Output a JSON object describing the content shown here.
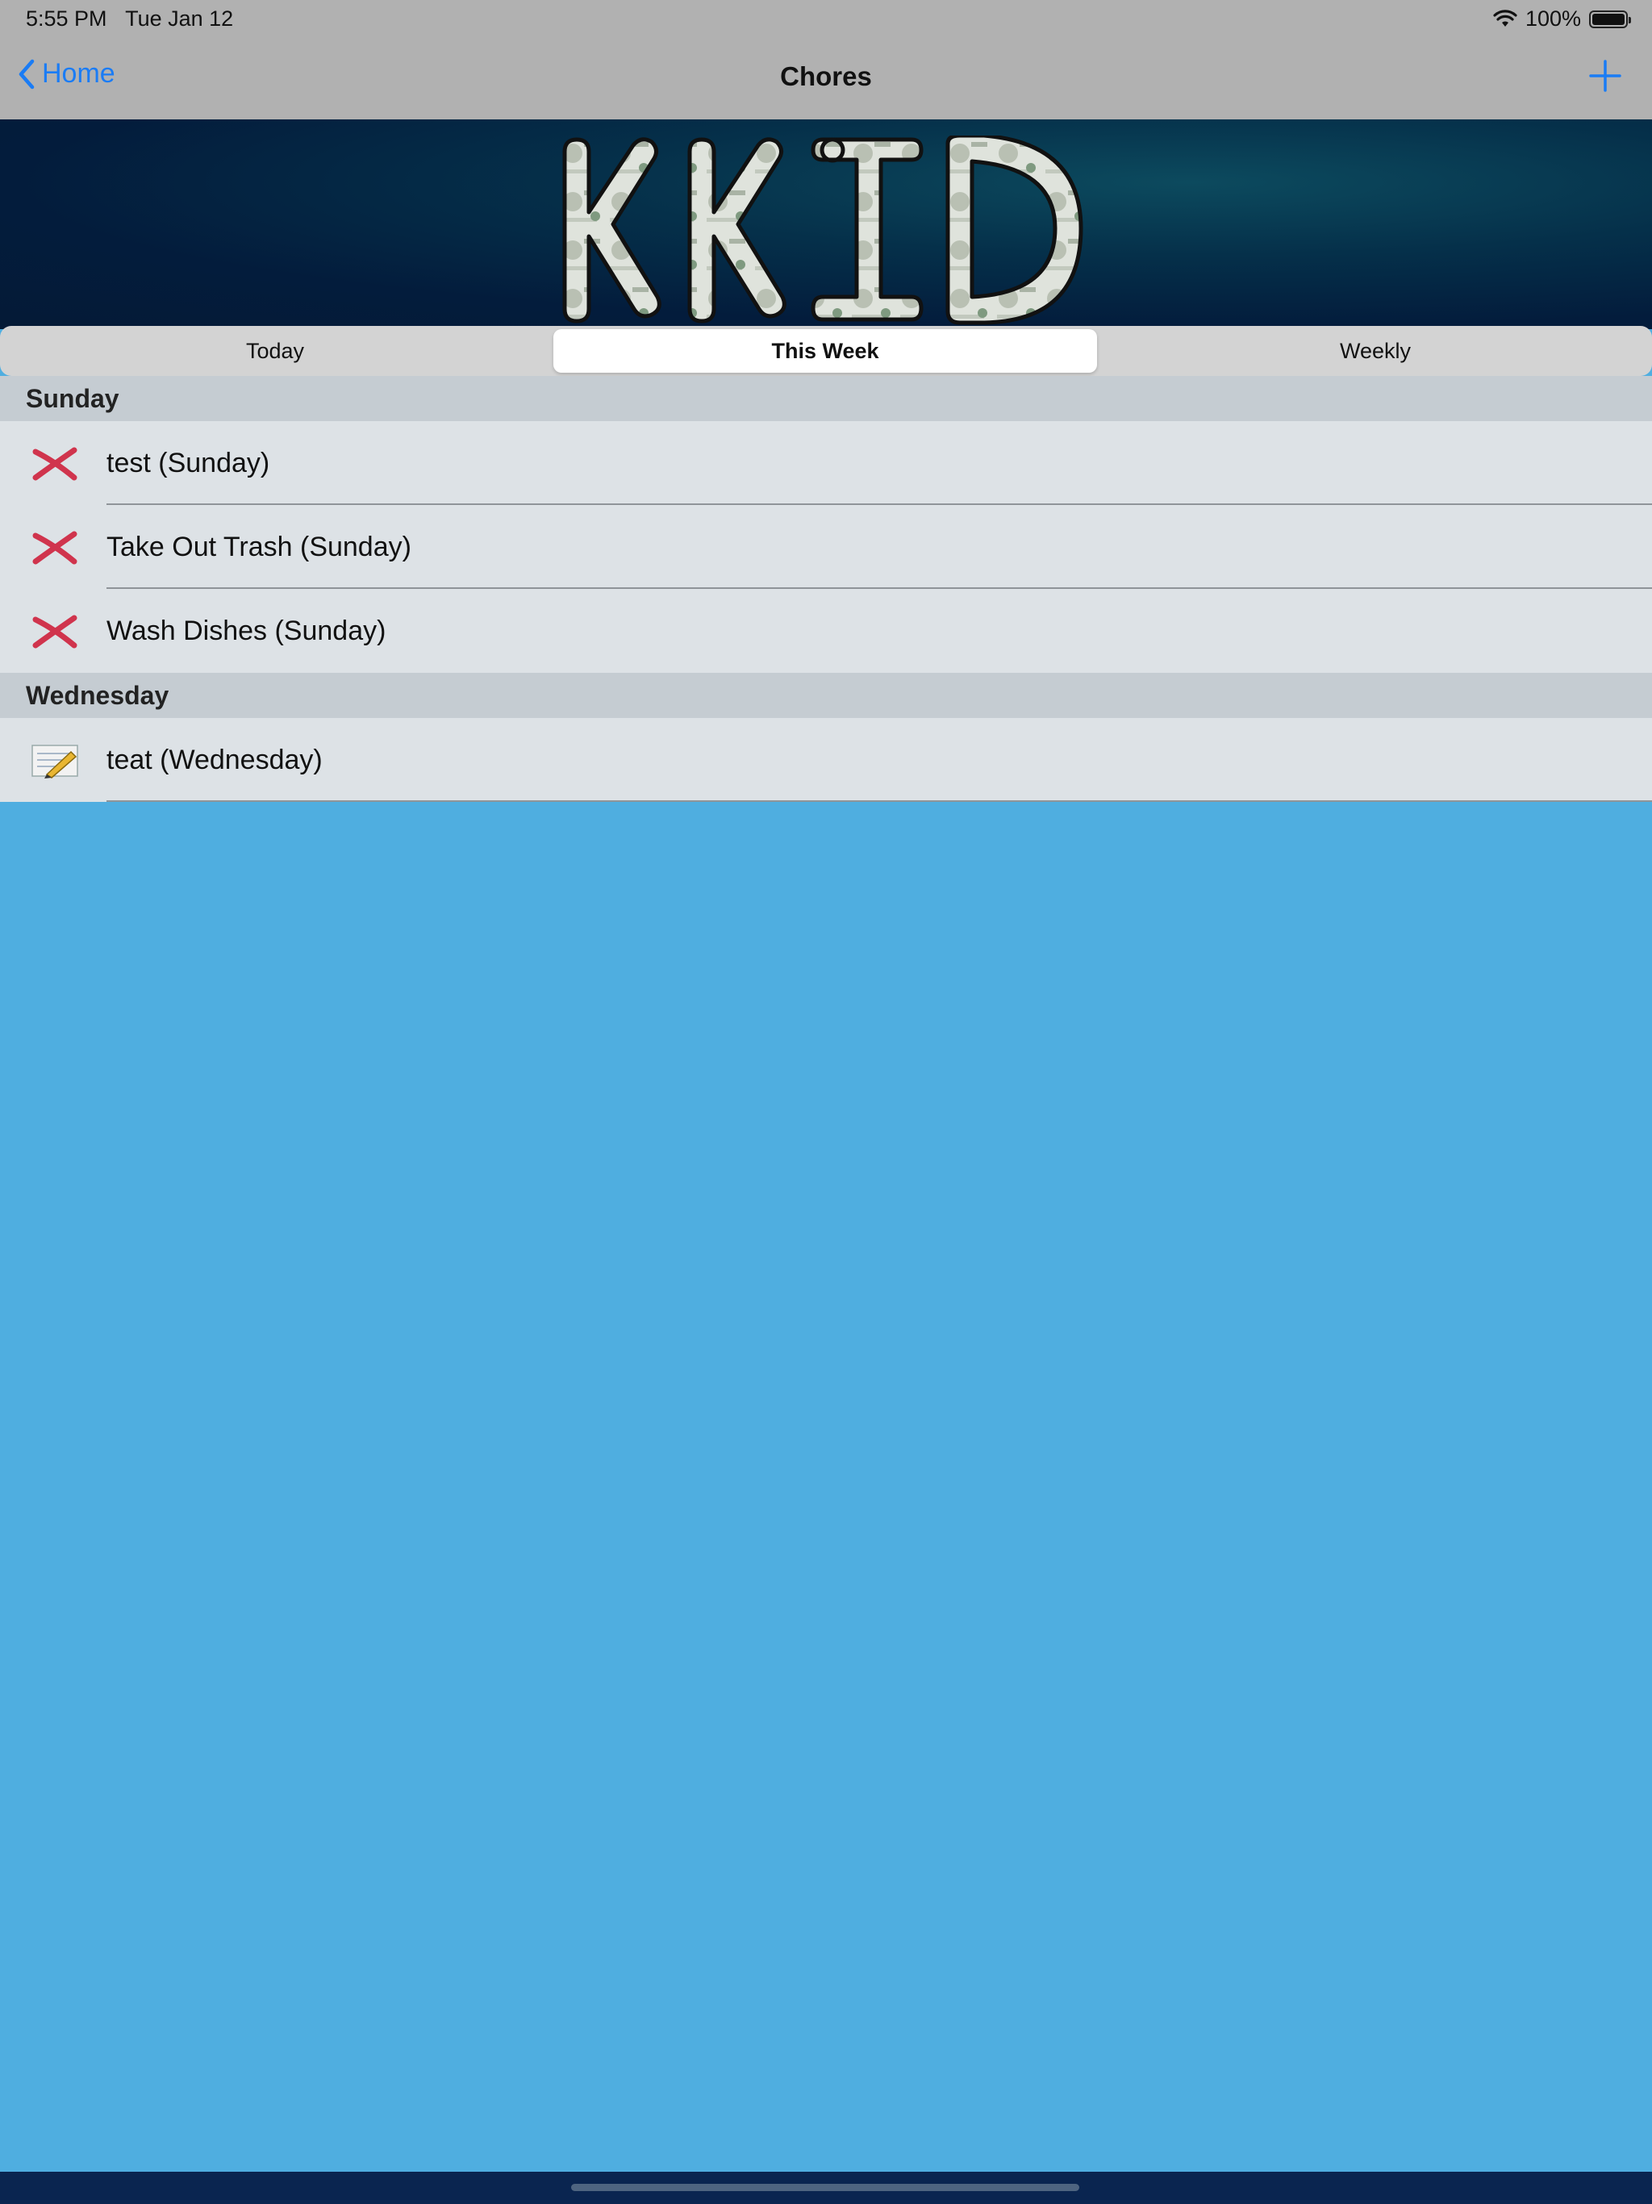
{
  "status_bar": {
    "time": "5:55 PM",
    "date": "Tue Jan 12",
    "battery": "100%",
    "wifi_icon": "wifi-icon",
    "battery_icon": "battery-icon"
  },
  "nav": {
    "back_label": "Home",
    "title": "Chores",
    "add_icon": "plus-icon"
  },
  "banner": {
    "logo_text": "KKID"
  },
  "segments": {
    "items": [
      "Today",
      "This Week",
      "Weekly"
    ],
    "selected": "This Week"
  },
  "sections": [
    {
      "header": "Sunday",
      "rows": [
        {
          "label": "test (Sunday)",
          "icon": "x-icon"
        },
        {
          "label": "Take Out Trash (Sunday)",
          "icon": "x-icon"
        },
        {
          "label": "Wash Dishes (Sunday)",
          "icon": "x-icon"
        }
      ]
    },
    {
      "header": "Wednesday",
      "rows": [
        {
          "label": "teat (Wednesday)",
          "icon": "notepad-pencil-icon"
        }
      ]
    }
  ],
  "colors": {
    "accent": "#1a7cf5",
    "x_mark": "#d0344d",
    "background": "#4faee0",
    "nav_bar": "#b1b1b1"
  }
}
